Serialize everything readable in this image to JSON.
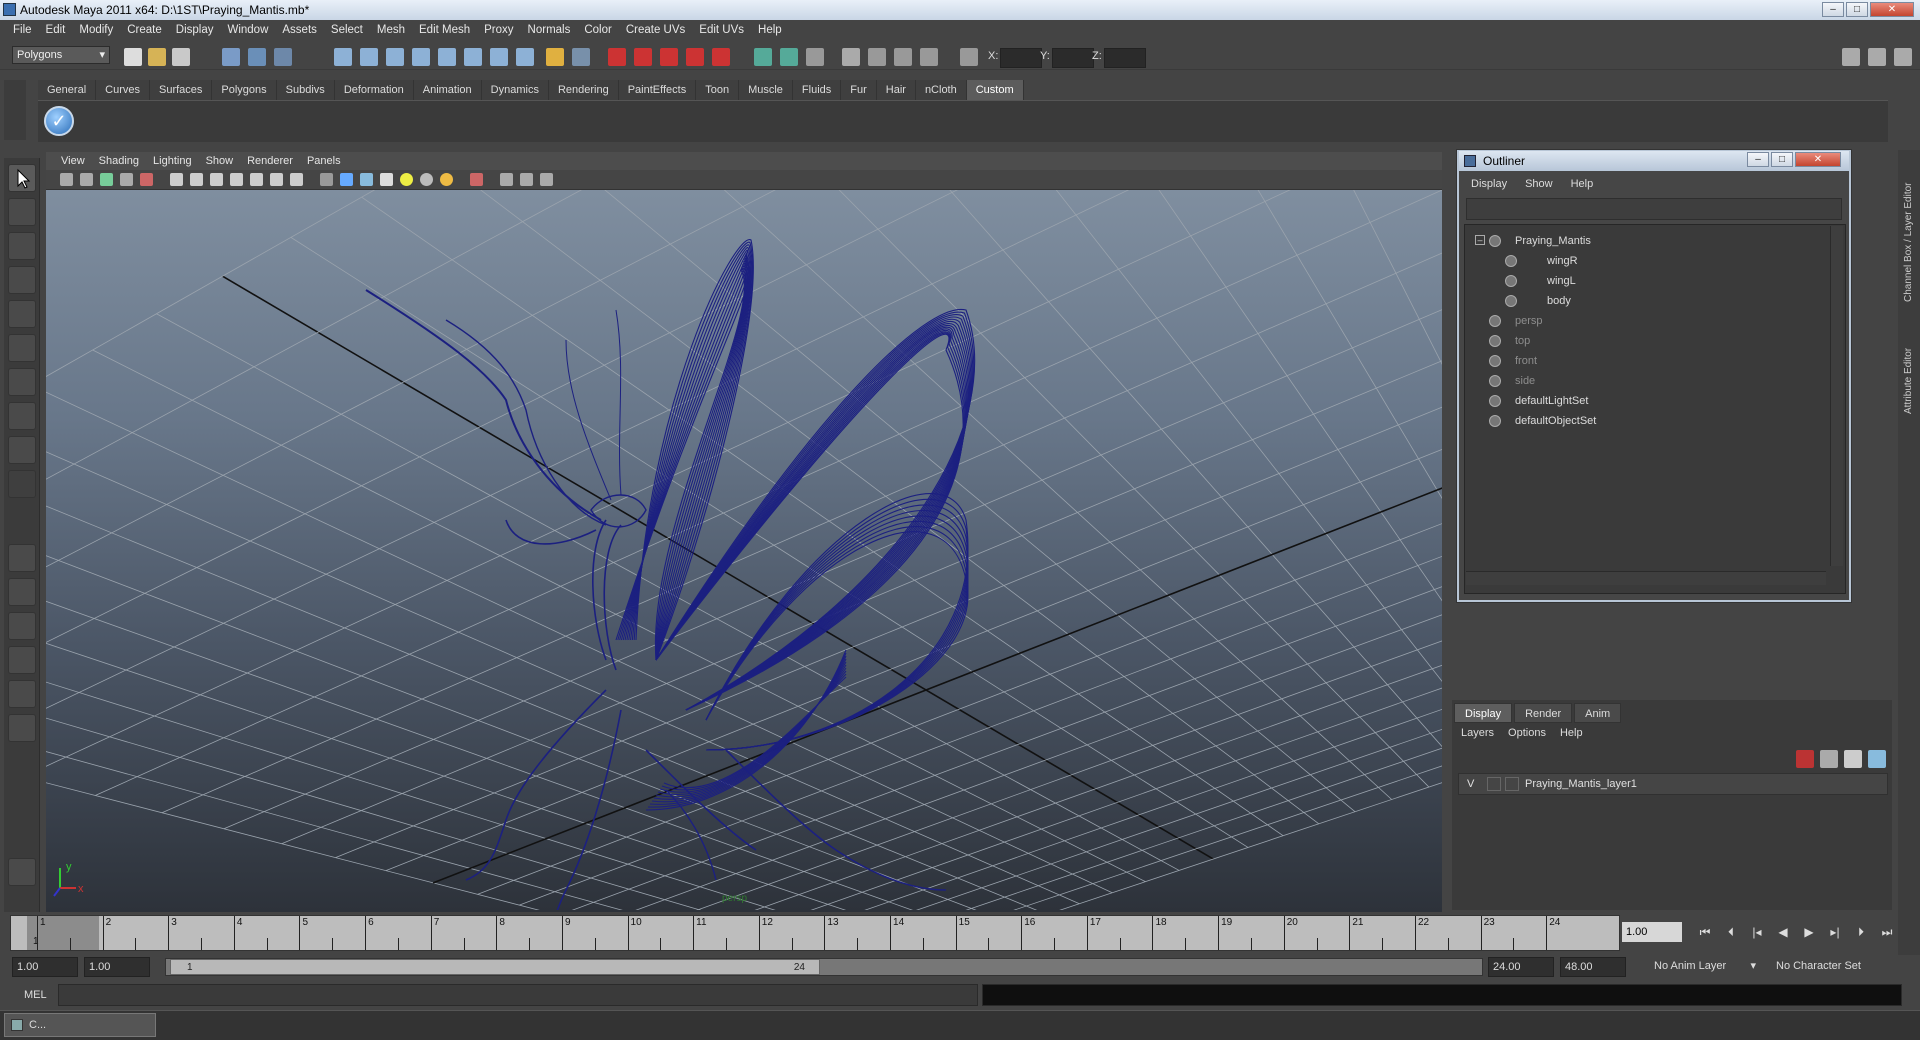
{
  "window": {
    "title": "Autodesk Maya 2011 x64: D:\\1ST\\Praying_Mantis.mb*",
    "min_label": "–",
    "max_label": "□",
    "close_label": "✕"
  },
  "menubar": [
    "File",
    "Edit",
    "Modify",
    "Create",
    "Display",
    "Window",
    "Assets",
    "Select",
    "Mesh",
    "Edit Mesh",
    "Proxy",
    "Normals",
    "Color",
    "Create UVs",
    "Edit UVs",
    "Help"
  ],
  "statusline": {
    "mode_select": "Polygons",
    "x_label": "X:",
    "y_label": "Y:",
    "z_label": "Z:"
  },
  "shelf_tabs": [
    "General",
    "Curves",
    "Surfaces",
    "Polygons",
    "Subdivs",
    "Deformation",
    "Animation",
    "Dynamics",
    "Rendering",
    "PaintEffects",
    "Toon",
    "Muscle",
    "Fluids",
    "Fur",
    "Hair",
    "nCloth",
    "Custom"
  ],
  "shelf_active_tab": "Custom",
  "viewport": {
    "menu": [
      "View",
      "Shading",
      "Lighting",
      "Show",
      "Renderer",
      "Panels"
    ],
    "camera_label": "persp",
    "axis_x": "x",
    "axis_y": "y",
    "wire_color": "#1c2080"
  },
  "outliner": {
    "title": "Outliner",
    "menu": [
      "Display",
      "Show",
      "Help"
    ],
    "items": [
      {
        "label": "Praying_Mantis",
        "indent": 0,
        "dim": false,
        "icon": "group-icon"
      },
      {
        "label": "wingR",
        "indent": 1,
        "dim": false,
        "icon": "mesh-icon"
      },
      {
        "label": "wingL",
        "indent": 1,
        "dim": false,
        "icon": "mesh-icon"
      },
      {
        "label": "body",
        "indent": 1,
        "dim": false,
        "icon": "mesh-icon"
      },
      {
        "label": "persp",
        "indent": 0,
        "dim": true,
        "icon": "camera-icon"
      },
      {
        "label": "top",
        "indent": 0,
        "dim": true,
        "icon": "camera-icon"
      },
      {
        "label": "front",
        "indent": 0,
        "dim": true,
        "icon": "camera-icon"
      },
      {
        "label": "side",
        "indent": 0,
        "dim": true,
        "icon": "camera-icon"
      },
      {
        "label": "defaultLightSet",
        "indent": 0,
        "dim": false,
        "icon": "set-icon"
      },
      {
        "label": "defaultObjectSet",
        "indent": 0,
        "dim": false,
        "icon": "set-icon"
      }
    ]
  },
  "right_strip": {
    "channel_box": "Channel Box / Layer Editor",
    "attribute_editor": "Attribute Editor"
  },
  "layers": {
    "tabs": [
      "Display",
      "Render",
      "Anim"
    ],
    "active_tab": "Display",
    "menu": [
      "Layers",
      "Options",
      "Help"
    ],
    "rows": [
      {
        "visible": "V",
        "name": "Praying_Mantis_layer1"
      }
    ]
  },
  "timeline": {
    "frames": [
      "1",
      "2",
      "3",
      "4",
      "5",
      "6",
      "7",
      "8",
      "9",
      "10",
      "11",
      "12",
      "13",
      "14",
      "15",
      "16",
      "17",
      "18",
      "19",
      "20",
      "21",
      "22",
      "23",
      "24"
    ],
    "current_frame_marker": "1",
    "current_frame": "1.00"
  },
  "range": {
    "start": "1.00",
    "anim_start": "1.00",
    "slider_start": "1",
    "slider_end": "24",
    "end": "24.00",
    "anim_end": "48.00",
    "anim_layer": "No Anim Layer",
    "character_set": "No Character Set"
  },
  "command_line": {
    "label": "MEL"
  },
  "taskbar": {
    "item": "C..."
  }
}
